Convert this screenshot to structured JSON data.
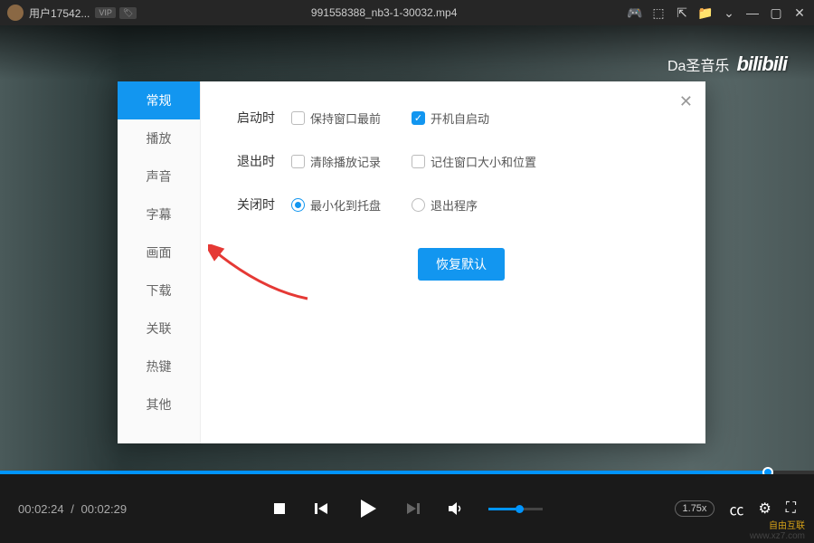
{
  "titlebar": {
    "username": "用户17542...",
    "vip": "VIP",
    "filename": "991558388_nb3-1-30032.mp4"
  },
  "watermark": {
    "text": "Da圣音乐",
    "logo": "bilibili"
  },
  "player": {
    "current": "00:02:24",
    "duration": "00:02:29",
    "speed": "1.75x"
  },
  "dialog": {
    "sidebar": [
      "常规",
      "播放",
      "声音",
      "字幕",
      "画面",
      "下载",
      "关联",
      "热键",
      "其他"
    ],
    "active": 0,
    "rows": [
      {
        "label": "启动时",
        "options": [
          {
            "type": "checkbox",
            "text": "保持窗口最前",
            "checked": false
          },
          {
            "type": "checkbox",
            "text": "开机自启动",
            "checked": true
          }
        ]
      },
      {
        "label": "退出时",
        "options": [
          {
            "type": "checkbox",
            "text": "清除播放记录",
            "checked": false
          },
          {
            "type": "checkbox",
            "text": "记住窗口大小和位置",
            "checked": false
          }
        ]
      },
      {
        "label": "关闭时",
        "options": [
          {
            "type": "radio",
            "text": "最小化到托盘",
            "checked": true
          },
          {
            "type": "radio",
            "text": "退出程序",
            "checked": false
          }
        ]
      }
    ],
    "restore": "恢复默认"
  },
  "footer": {
    "brand": "自由互联",
    "url": "www.xz7.com"
  }
}
